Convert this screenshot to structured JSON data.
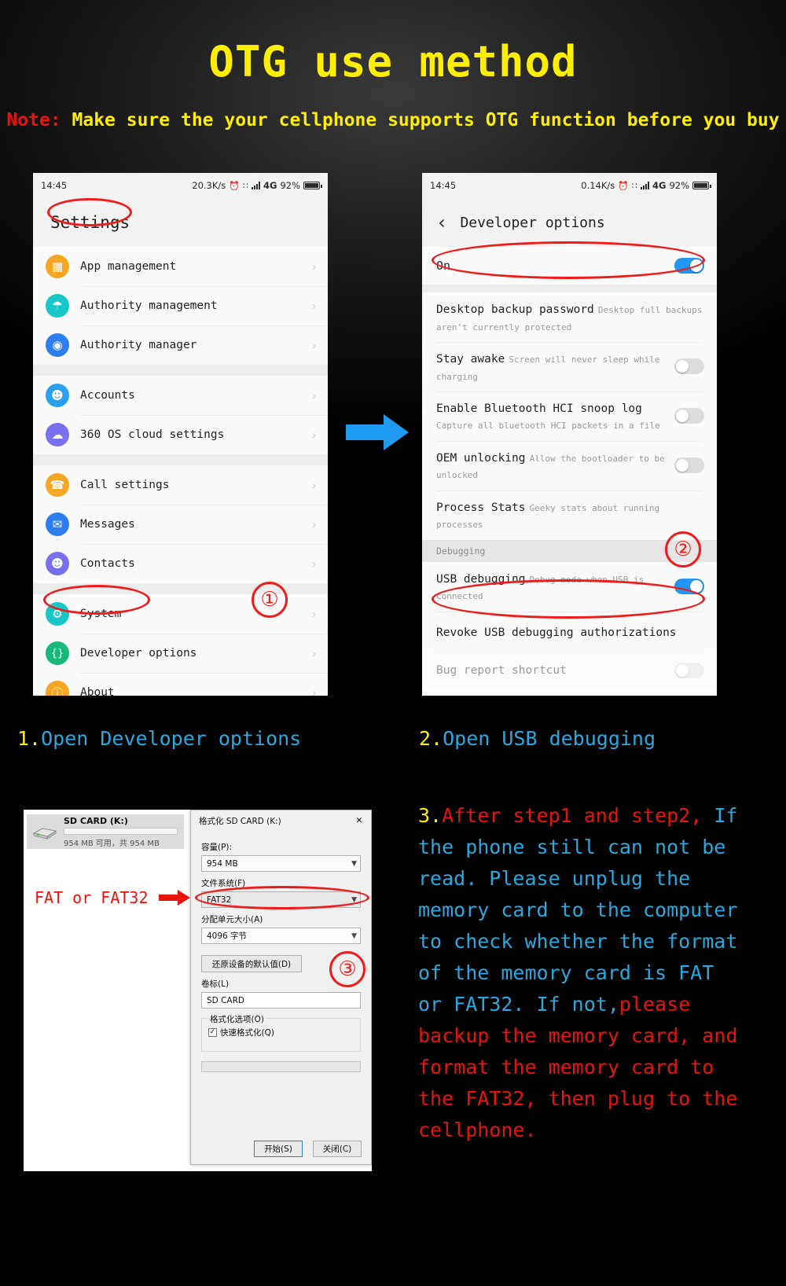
{
  "header": {
    "title": "OTG use method",
    "note_prefix": "Note:",
    "note_text": "Make sure the your cellphone supports OTG function before you buy"
  },
  "colors": {
    "yellow": "#ffee00",
    "red": "#e8140c",
    "blue_caption": "#2aa9e0",
    "toggle_on": "#2196f3",
    "annotation_red": "#ee1c1c"
  },
  "phone1": {
    "statusbar": {
      "time": "14:45",
      "speed": "20.3K/s",
      "alarm_icon": "alarm-icon",
      "network": "4G",
      "battery": "92%"
    },
    "title": "Settings",
    "items": [
      {
        "label": "App management",
        "icon": "apps-grid-icon",
        "color": "#f6a623",
        "glyph": "▦"
      },
      {
        "label": "Authority management",
        "icon": "shield-icon",
        "color": "#17c6c6",
        "glyph": "⛨"
      },
      {
        "label": "Authority manager",
        "icon": "android-robot-icon",
        "color": "#2d7ff0",
        "glyph": "◔"
      },
      {
        "label": "Accounts",
        "icon": "person-icon",
        "color": "#2aa1ee",
        "glyph": "●"
      },
      {
        "label": "360 OS cloud settings",
        "icon": "cloud-icon",
        "color": "#7a6ff0",
        "glyph": "☁"
      },
      {
        "label": "Call settings",
        "icon": "phone-icon",
        "color": "#f6a623",
        "glyph": "☎"
      },
      {
        "label": "Messages",
        "icon": "message-icon",
        "color": "#2d7ff0",
        "glyph": "✉"
      },
      {
        "label": "Contacts",
        "icon": "contacts-icon",
        "color": "#7a6ff0",
        "glyph": "●"
      },
      {
        "label": "System",
        "icon": "gear-icon",
        "color": "#17c6c6",
        "glyph": "⚙"
      },
      {
        "label": "Developer options",
        "icon": "braces-icon",
        "color": "#17b97a",
        "glyph": "{}"
      },
      {
        "label": "About",
        "icon": "info-icon",
        "color": "#f6a623",
        "glyph": "ℹ"
      }
    ],
    "chevron": "›",
    "annotation_number": "①"
  },
  "phone2": {
    "statusbar": {
      "time": "14:45",
      "speed": "0.14K/s",
      "alarm_icon": "alarm-icon",
      "network": "4G",
      "battery": "92%"
    },
    "back_icon": "back-chevron-icon",
    "title": "Developer options",
    "master_switch": {
      "label": "On",
      "state": "on"
    },
    "items": [
      {
        "title": "Desktop backup password",
        "subtitle": "Desktop full backups aren't currently protected",
        "toggle": null
      },
      {
        "title": "Stay awake",
        "subtitle": "Screen will never sleep while charging",
        "toggle": "off"
      },
      {
        "title": "Enable Bluetooth HCI snoop log",
        "subtitle": "Capture all bluetooth HCI packets in a file",
        "toggle": "off"
      },
      {
        "title": "OEM unlocking",
        "subtitle": "Allow the bootloader to be unlocked",
        "toggle": "off"
      },
      {
        "title": "Process Stats",
        "subtitle": "Geeky stats about running processes",
        "toggle": null
      }
    ],
    "section_header": "Debugging",
    "debug_items": [
      {
        "title": "USB debugging",
        "subtitle": "Debug mode when USB is connected",
        "toggle": "on"
      },
      {
        "title": "Revoke USB debugging authorizations",
        "subtitle": "",
        "toggle": null
      },
      {
        "title": "Bug report shortcut",
        "subtitle": "",
        "toggle": "off"
      }
    ],
    "annotation_number": "②"
  },
  "captions": {
    "step1_num": "1.",
    "step1_text": "Open Developer options",
    "step2_num": "2.",
    "step2_text": "Open USB debugging"
  },
  "step3": {
    "num": "3.",
    "line1_red": "After step1 and step2,",
    "blue_block": "If the phone still can not be read. Please unplug the memory card to the computer to check whether the format of the memory card is FAT or FAT32.",
    "blue_tail": "If not,",
    "red_block": "please backup the memory card, and format the memory card to the FAT32, then plug to the cellphone."
  },
  "windows": {
    "drive": {
      "name": "SD CARD (K:)",
      "free_text": "954 MB 可用，共 954 MB"
    },
    "dialog": {
      "title": "格式化 SD CARD (K:)",
      "close_icon": "close-icon",
      "capacity_label": "容量(P):",
      "capacity_value": "954 MB",
      "filesystem_label": "文件系统(F)",
      "filesystem_value": "FAT32",
      "allocation_label": "分配单元大小(A)",
      "allocation_value": "4096 字节",
      "restore_button": "还原设备的默认值(D)",
      "volume_label": "卷标(L)",
      "volume_value": "SD CARD",
      "options_group": "格式化选项(O)",
      "quick_format": "快速格式化(Q)",
      "quick_format_checked": true,
      "start_button": "开始(S)",
      "close_button": "关闭(C)",
      "annotation_number": "③"
    },
    "fat_label": "FAT or FAT32"
  }
}
